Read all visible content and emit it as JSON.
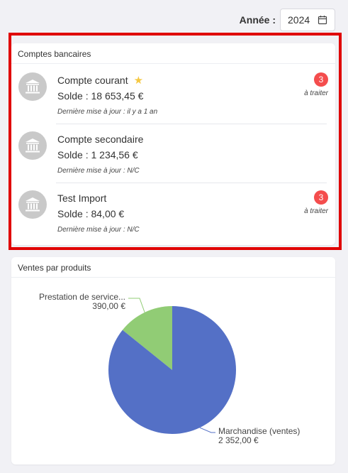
{
  "header": {
    "year_label": "Année :",
    "year_value": "2024"
  },
  "accounts_card": {
    "title": "Comptes bancaires",
    "accounts": [
      {
        "name": "Compte courant",
        "favorite": true,
        "balance": "Solde : 18 653,45 €",
        "updated": "Dernière mise à jour : il y a 1 an",
        "badge": "3",
        "todo": "à traiter"
      },
      {
        "name": "Compte secondaire",
        "favorite": false,
        "balance": "Solde : 1 234,56 €",
        "updated": "Dernière mise à jour : N/C",
        "badge": null,
        "todo": null
      },
      {
        "name": "Test Import",
        "favorite": false,
        "balance": "Solde : 84,00 €",
        "updated": "Dernière mise à jour : N/C",
        "badge": "3",
        "todo": "à traiter"
      }
    ]
  },
  "sales_card": {
    "title": "Ventes par produits"
  },
  "chart_data": {
    "type": "pie",
    "slices": [
      {
        "label": "Prestation de service...",
        "value_label": "390,00 €",
        "value": 390.0,
        "color": "#91cc75"
      },
      {
        "label": "Marchandise (ventes)",
        "value_label": "2 352,00 €",
        "value": 2352.0,
        "color": "#5470c6"
      }
    ]
  },
  "icons": {
    "calendar": "calendar-icon",
    "bank": "bank-icon",
    "star": "star-icon"
  }
}
